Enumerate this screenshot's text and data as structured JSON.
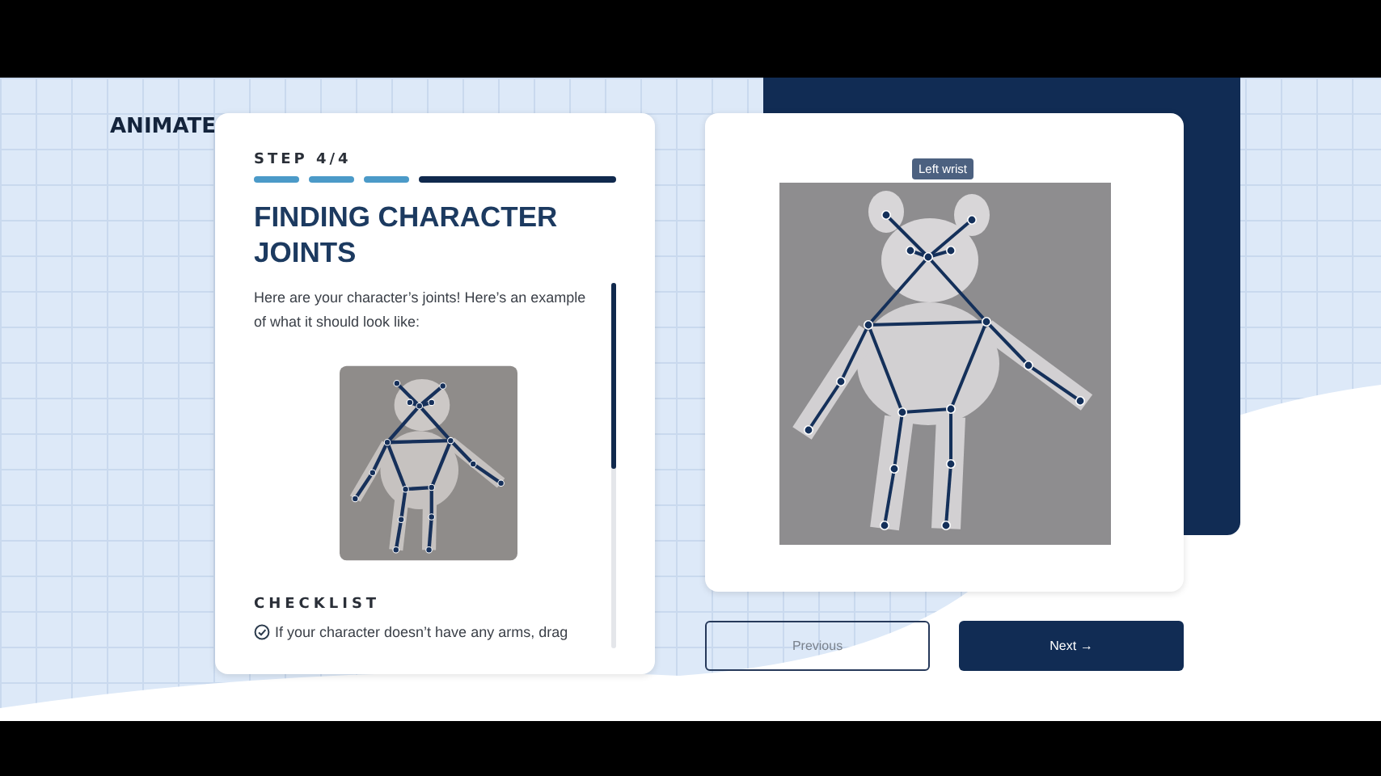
{
  "logo": "ANIMATE",
  "step": {
    "label": "STEP 4/4",
    "segments": [
      {
        "kind": "done"
      },
      {
        "kind": "done"
      },
      {
        "kind": "done"
      },
      {
        "kind": "current"
      }
    ]
  },
  "title": "FINDING CHARACTER JOINTS",
  "intro": "Here are your character’s joints! Here’s an example of what it should look like:",
  "checklist": {
    "heading": "CHECKLIST",
    "items": [
      "If your character doesn’t have any arms, drag"
    ]
  },
  "tooltip": "Left wrist",
  "buttons": [
    {
      "label": "Previous",
      "kind": "secondary"
    },
    {
      "label": "Next →",
      "kind": "primary"
    }
  ]
}
